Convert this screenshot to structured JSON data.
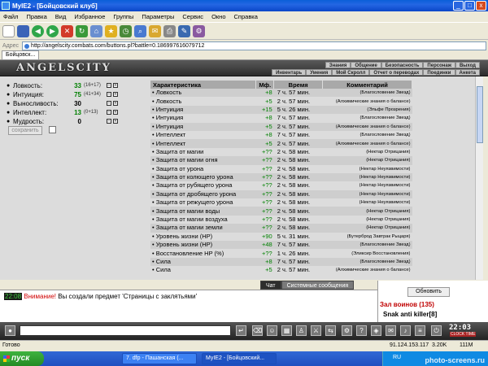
{
  "window": {
    "title": "MyIE2 - [Бойцовский клуб]",
    "controls": [
      "_",
      "□",
      "x"
    ]
  },
  "menu": [
    "Файл",
    "Правка",
    "Вид",
    "Избранное",
    "Группы",
    "Параметры",
    "Сервис",
    "Окно",
    "Справка"
  ],
  "toolbar": {
    "icons": [
      "new-page-icon",
      "save-icon",
      "back-icon",
      "forward-icon",
      "stop-icon",
      "refresh-icon",
      "home-icon",
      "favorites-icon",
      "history-icon",
      "search-icon",
      "mail-icon",
      "print-icon",
      "edit-icon",
      "options-icon"
    ]
  },
  "address": {
    "label": "Адрес",
    "url": "http://angelscity.combats.com/buttons.pl?battle=0.186997616079712"
  },
  "tabs": [
    {
      "label": "Бойцовск..."
    }
  ],
  "game": {
    "logo": "ANGELSCITY",
    "nav_top": [
      "Знания",
      "Общение",
      "Безопасность",
      "Персонаж",
      "Выход"
    ],
    "nav_bottom": [
      "Инвентарь",
      "Умения",
      "Мой Скролл",
      "Отчет о переводах",
      "Поединки",
      "Анкета"
    ]
  },
  "stats": [
    {
      "name": "Ловкость:",
      "value": "33",
      "bonus": "(16+17)",
      "green": true
    },
    {
      "name": "Интуиция:",
      "value": "75",
      "bonus": "(41+34)",
      "green": true
    },
    {
      "name": "Выносливость:",
      "value": "30",
      "bonus": "",
      "green": false
    },
    {
      "name": "Интеллект:",
      "value": "13",
      "bonus": "(0+13)",
      "green": true
    },
    {
      "name": "Мудрость:",
      "value": "0",
      "bonus": "",
      "green": false
    }
  ],
  "save_button": "сохранить",
  "effects_table": {
    "headers": [
      "Характеристика",
      "Мф.",
      "Время",
      "Комментарий"
    ],
    "rows": [
      [
        "• Ловкость",
        "+8",
        "7 ч. 57 мин.",
        "(Благословение Звезд)"
      ],
      [
        "• Ловкость",
        "+5",
        "2 ч. 57 мин.",
        "(Алхимические знания о балансе)"
      ],
      [
        "• Интуиция",
        "+15",
        "5 ч. 26 мин.",
        "(Эльфе Прозрения)"
      ],
      [
        "• Интуиция",
        "+8",
        "7 ч. 57 мин.",
        "(Благословение Звезд)"
      ],
      [
        "• Интуиция",
        "+5",
        "2 ч. 57 мин.",
        "(Алхимические знания о балансе)"
      ],
      [
        "• Интеллект",
        "+8",
        "7 ч. 57 мин.",
        "(Благословение Звезд)"
      ],
      [
        "• Интеллект",
        "+5",
        "2 ч. 57 мин.",
        "(Алхимические знания о балансе)"
      ],
      [
        "• Защита от магии",
        "+??",
        "2 ч. 58 мин.",
        "(Нектар Отрицания)"
      ],
      [
        "• Защита от магии огня",
        "+??",
        "2 ч. 58 мин.",
        "(Нектар Отрицания)"
      ],
      [
        "• Защита от урона",
        "+??",
        "2 ч. 58 мин.",
        "(Нектар Неуязвимости)"
      ],
      [
        "• Защита от колющего урона",
        "+??",
        "2 ч. 58 мин.",
        "(Нектар Неуязвимости)"
      ],
      [
        "• Защита от рубящего урона",
        "+??",
        "2 ч. 58 мин.",
        "(Нектар Неуязвимости)"
      ],
      [
        "• Защита от дробящего урона",
        "+??",
        "2 ч. 58 мин.",
        "(Нектар Неуязвимости)"
      ],
      [
        "• Защита от режущего урона",
        "+??",
        "2 ч. 58 мин.",
        "(Нектар Неуязвимости)"
      ],
      [
        "• Защита от магии воды",
        "+??",
        "2 ч. 58 мин.",
        "(Нектар Отрицания)"
      ],
      [
        "• Защита от магии воздуха",
        "+??",
        "2 ч. 58 мин.",
        "(Нектар Отрицания)"
      ],
      [
        "• Защита от магии земли",
        "+??",
        "2 ч. 58 мин.",
        "(Нектар Отрицания)"
      ],
      [
        "• Уровень жизни (HP)",
        "+90",
        "5 ч. 31 мин.",
        "(Бутерброд Завтрак Рыцаря)"
      ],
      [
        "• Уровень жизни (HP)",
        "+48",
        "7 ч. 57 мин.",
        "(Благословение Звезд)"
      ],
      [
        "• Восстановление HP (%)",
        "+??",
        "1 ч. 26 мин.",
        "(Эликсир Восстановления)"
      ],
      [
        "• Сила",
        "+8",
        "7 ч. 57 мин.",
        "(Благословение Звезд)"
      ],
      [
        "• Сила",
        "+5",
        "2 ч. 57 мин.",
        "(Алхимические знания о балансе)"
      ]
    ]
  },
  "chat": {
    "tabs": [
      "Чат",
      "Системные сообщения"
    ],
    "time": "22:08",
    "warning": "Внимание!",
    "message": " Вы создали предмет 'Страницы с заклятьями'"
  },
  "right_chat": {
    "refresh": "Обновить",
    "room": "Зал воинов (135)",
    "player": "Snak anti killer[8]"
  },
  "bottom": {
    "clock": "22:03",
    "clock_sub": "CLOCK TIME"
  },
  "statusbar": {
    "left": "Готово",
    "ip": "91.124.153.117",
    "speed": "3.20K",
    "mem": "111M"
  },
  "taskbar": {
    "start": "пуск",
    "tasks": [
      "7. dfp - Пашанская (...",
      "MyIE2 - [Бойцовский..."
    ],
    "lang": "RU"
  },
  "watermark": "photo-screens.ru",
  "colors": {
    "accent_green": "#008000",
    "warning_red": "#d00000",
    "title_blue": "#0A5FD8"
  }
}
